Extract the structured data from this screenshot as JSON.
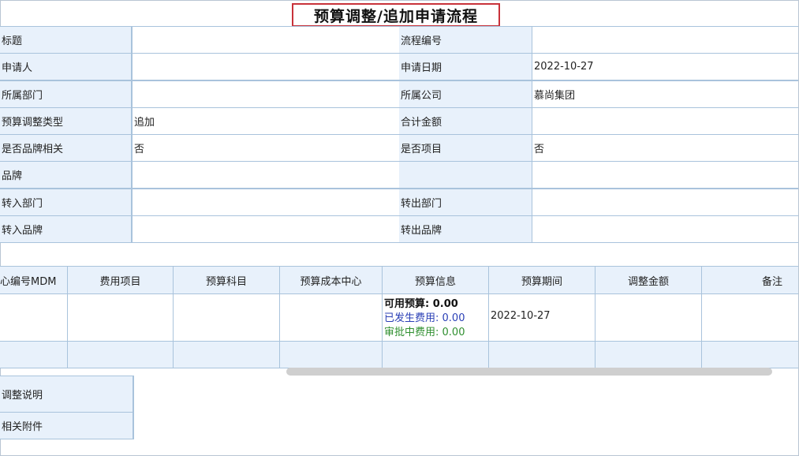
{
  "page_title": "预算调整/追加申请流程",
  "form": {
    "rows": [
      {
        "label1": "标题",
        "value1": "",
        "label2": "流程编号",
        "value2": ""
      },
      {
        "label1": "申请人",
        "value1": "",
        "label2": "申请日期",
        "value2": "2022-10-27"
      },
      {
        "label1": "所属部门",
        "value1": "",
        "label2": "所属公司",
        "value2": "慕尚集团"
      },
      {
        "label1": "预算调整类型",
        "value1": "追加",
        "label2": "合计金额",
        "value2": ""
      },
      {
        "label1": "是否品牌相关",
        "value1": "否",
        "label2": "是否项目",
        "value2": "否"
      },
      {
        "label1": "品牌",
        "value1": "",
        "label2": "",
        "value2": ""
      },
      {
        "label1": "转入部门",
        "value1": "",
        "label2": "转出部门",
        "value2": ""
      },
      {
        "label1": "转入品牌",
        "value1": "",
        "label2": "转出品牌",
        "value2": ""
      }
    ]
  },
  "detail_table": {
    "headers": [
      "心编号MDM",
      "费用项目",
      "预算科目",
      "预算成本中心",
      "预算信息",
      "预算期间",
      "调整金额",
      "备注"
    ],
    "row": {
      "mdm": "",
      "expense_item": "",
      "budget_subject": "",
      "cost_center": "",
      "available_label": "可用预算:",
      "available_value": "0.00",
      "used_label": "已发生费用:",
      "used_value": "0.00",
      "pending_label": "审批中费用:",
      "pending_value": "0.00",
      "period": "2022-10-27",
      "adjust_amount": "",
      "remark": ""
    }
  },
  "bottom": {
    "adjust_note_label": "调整说明",
    "attachment_label": "相关附件"
  },
  "colors": {
    "label_bg": "#e8f1fb",
    "border": "#a9c3dc",
    "title_border": "#c8323a",
    "used_text": "#2a3fb6",
    "pending_text": "#2f8f2f"
  }
}
